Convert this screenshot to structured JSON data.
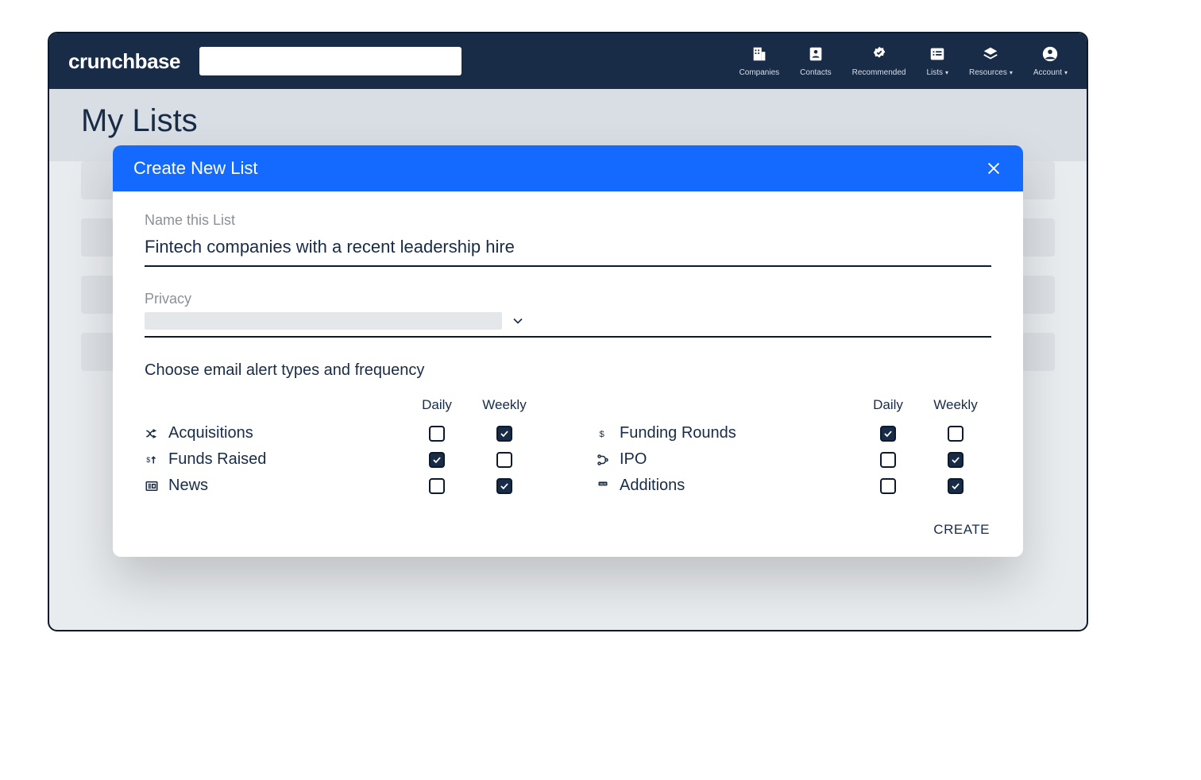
{
  "brand": "crunchbase",
  "nav": [
    {
      "label": "Companies",
      "icon": "building",
      "dropdown": false
    },
    {
      "label": "Contacts",
      "icon": "contact",
      "dropdown": false
    },
    {
      "label": "Recommended",
      "icon": "badge",
      "dropdown": false
    },
    {
      "label": "Lists",
      "icon": "list",
      "dropdown": true
    },
    {
      "label": "Resources",
      "icon": "layers",
      "dropdown": true
    },
    {
      "label": "Account",
      "icon": "account",
      "dropdown": true
    }
  ],
  "page_title": "My Lists",
  "modal": {
    "title": "Create New List",
    "name_label": "Name this List",
    "name_value": "Fintech companies with a recent leadership hire",
    "privacy_label": "Privacy",
    "section_title": "Choose email alert types and frequency",
    "col_daily": "Daily",
    "col_weekly": "Weekly",
    "left": [
      {
        "icon": "merge",
        "name": "Acquisitions",
        "daily": false,
        "weekly": true
      },
      {
        "icon": "dollar-up",
        "name": "Funds Raised",
        "daily": true,
        "weekly": false
      },
      {
        "icon": "news",
        "name": "News",
        "daily": false,
        "weekly": true
      }
    ],
    "right": [
      {
        "icon": "dollar",
        "name": "Funding Rounds",
        "daily": true,
        "weekly": false
      },
      {
        "icon": "ipo",
        "name": "IPO",
        "daily": false,
        "weekly": true
      },
      {
        "icon": "new",
        "name": "Additions",
        "daily": false,
        "weekly": true
      }
    ],
    "create_label": "CREATE"
  }
}
